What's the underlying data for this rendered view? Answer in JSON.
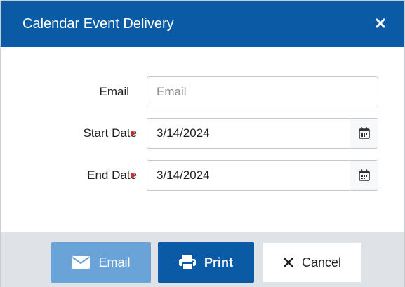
{
  "dialog": {
    "title": "Calendar Event Delivery",
    "close_icon": "close-icon"
  },
  "form": {
    "email": {
      "label": "Email",
      "placeholder": "Email",
      "value": ""
    },
    "start_date": {
      "label": "Start Date",
      "value": "3/14/2024",
      "required": true,
      "icon": "calendar-icon"
    },
    "end_date": {
      "label": "End Date",
      "value": "3/14/2024",
      "required": true,
      "icon": "calendar-icon"
    }
  },
  "footer": {
    "email_button": {
      "label": "Email",
      "icon": "envelope-icon"
    },
    "print_button": {
      "label": "Print",
      "icon": "printer-icon"
    },
    "cancel_button": {
      "label": "Cancel",
      "icon": "x-icon"
    }
  },
  "colors": {
    "header": "#0b5aa6",
    "required": "#d62b2b",
    "email_button": "#6aa3d7",
    "print_button": "#0b5aa6",
    "footer": "#dfe3e8"
  }
}
